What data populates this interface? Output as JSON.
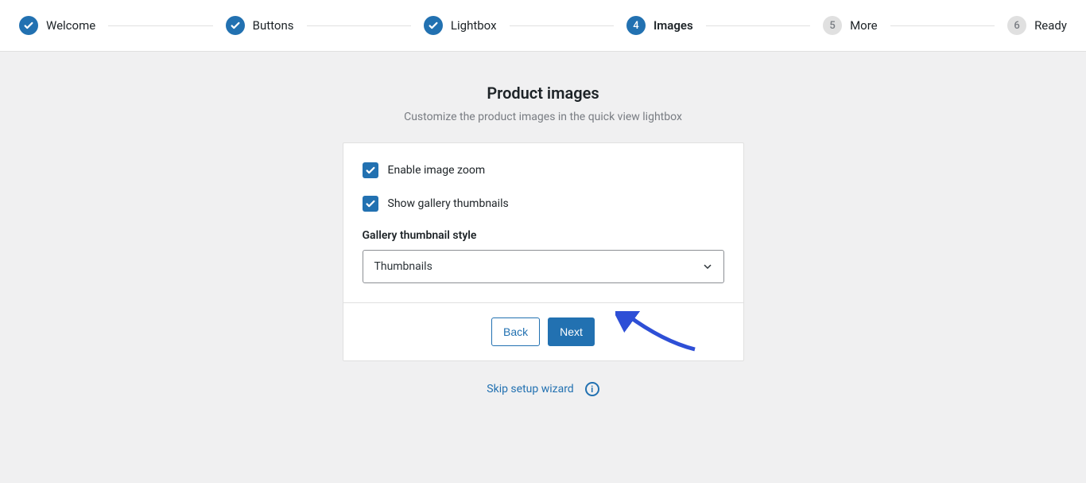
{
  "stepper": {
    "steps": [
      {
        "label": "Welcome",
        "state": "done"
      },
      {
        "label": "Buttons",
        "state": "done"
      },
      {
        "label": "Lightbox",
        "state": "done"
      },
      {
        "label": "Images",
        "state": "current",
        "number": "4"
      },
      {
        "label": "More",
        "state": "pending",
        "number": "5"
      },
      {
        "label": "Ready",
        "state": "pending",
        "number": "6"
      }
    ]
  },
  "header": {
    "title": "Product images",
    "subtitle": "Customize the product images in the quick view lightbox"
  },
  "form": {
    "enableZoom": {
      "label": "Enable image zoom",
      "checked": true
    },
    "showThumbnails": {
      "label": "Show gallery thumbnails",
      "checked": true
    },
    "thumbnailStyle": {
      "label": "Gallery thumbnail style",
      "value": "Thumbnails"
    }
  },
  "footer": {
    "back": "Back",
    "next": "Next",
    "skip": "Skip setup wizard"
  }
}
